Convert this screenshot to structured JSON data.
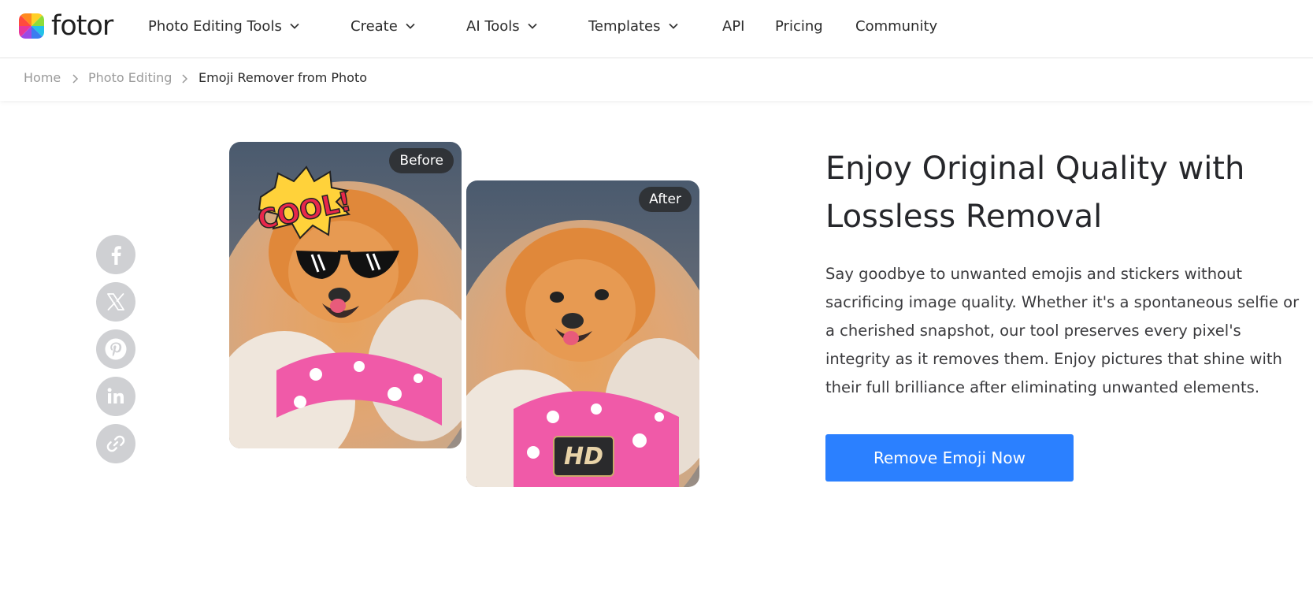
{
  "brand": {
    "name": "fotor"
  },
  "nav": {
    "items": [
      {
        "label": "Photo Editing Tools",
        "has_dropdown": true
      },
      {
        "label": "Create",
        "has_dropdown": true
      },
      {
        "label": "AI Tools",
        "has_dropdown": true
      },
      {
        "label": "Templates",
        "has_dropdown": true
      },
      {
        "label": "API",
        "has_dropdown": false
      },
      {
        "label": "Pricing",
        "has_dropdown": false
      },
      {
        "label": "Community",
        "has_dropdown": false
      }
    ]
  },
  "breadcrumb": [
    "Home",
    "Photo Editing",
    "Emoji Remover from Photo"
  ],
  "share": {
    "icons": [
      "facebook-icon",
      "x-icon",
      "pinterest-icon",
      "linkedin-icon",
      "link-icon"
    ]
  },
  "comparison": {
    "before_label": "Before",
    "after_label": "After",
    "sticker_text": "COOL!",
    "hd_badge": "HD"
  },
  "content": {
    "headline": "Enjoy Original Quality with Lossless Removal",
    "description": "Say goodbye to unwanted emojis and stickers without sacrificing image quality. Whether it's a spontaneous selfie or a cherished snapshot, our tool preserves every pixel's integrity as it removes them. Enjoy pictures that shine with their full brilliance after eliminating unwanted elements.",
    "cta_label": "Remove Emoji Now"
  },
  "colors": {
    "accent": "#2b80ff",
    "share_bg": "#cfd0d3",
    "text_dark": "#26272b",
    "crumb_muted": "#9a9a9a"
  }
}
